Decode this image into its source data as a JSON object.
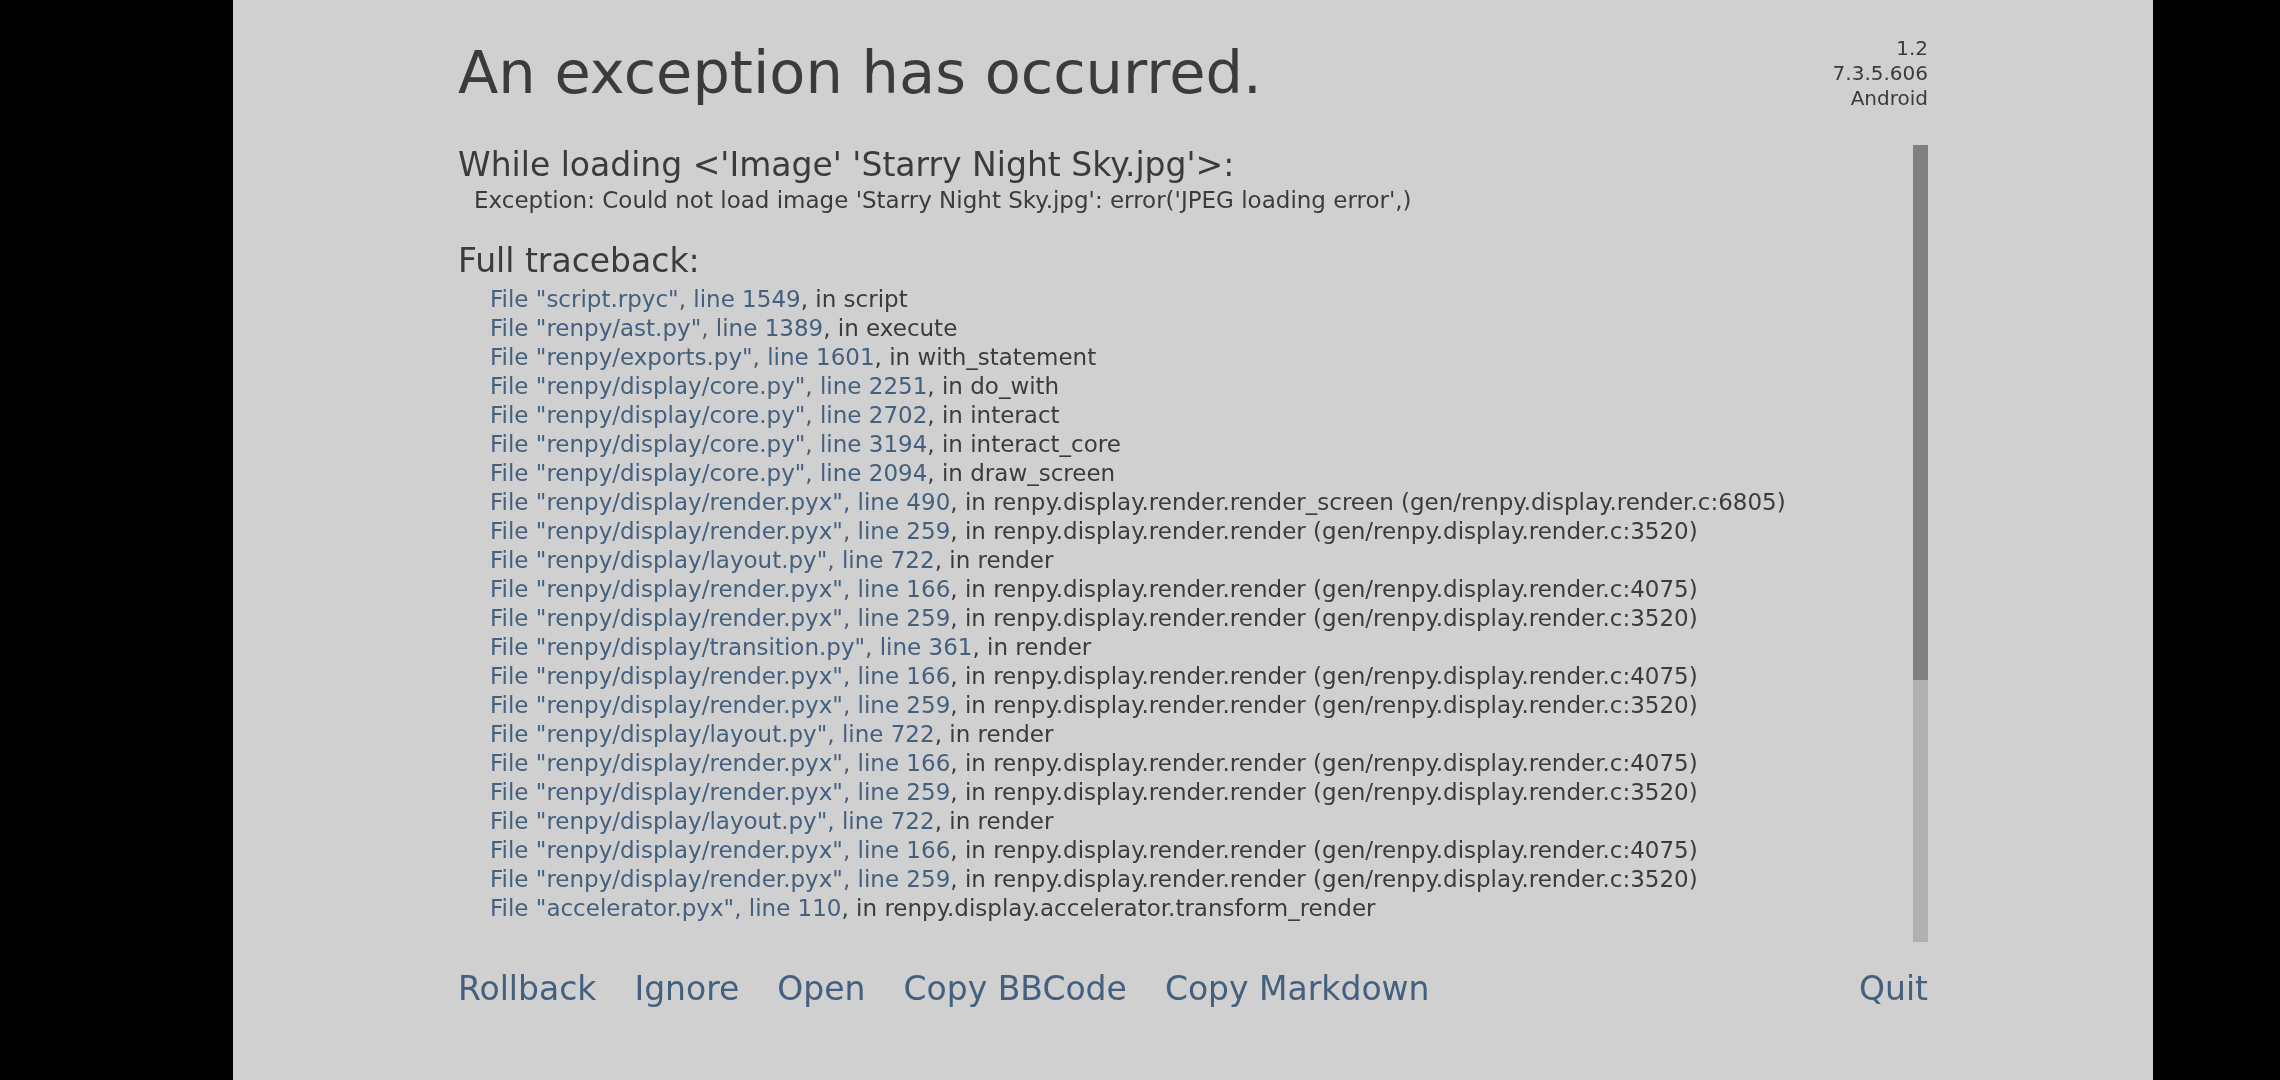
{
  "title": "An exception has occurred.",
  "version_info": [
    "1.2",
    "7.3.5.606",
    "Android"
  ],
  "loading_heading": "While loading <'Image' 'Starry Night Sky.jpg'>:",
  "exception": "Exception: Could not load image 'Starry Night Sky.jpg': error('JPEG loading error',)",
  "traceback_heading": "Full traceback:",
  "traceback": [
    {
      "file": "File \"script.rpyc\", line 1549",
      "rest": ", in script"
    },
    {
      "file": "File \"renpy/ast.py\", line 1389",
      "rest": ", in execute"
    },
    {
      "file": "File \"renpy/exports.py\", line 1601",
      "rest": ", in with_statement"
    },
    {
      "file": "File \"renpy/display/core.py\", line 2251",
      "rest": ", in do_with"
    },
    {
      "file": "File \"renpy/display/core.py\", line 2702",
      "rest": ", in interact"
    },
    {
      "file": "File \"renpy/display/core.py\", line 3194",
      "rest": ", in interact_core"
    },
    {
      "file": "File \"renpy/display/core.py\", line 2094",
      "rest": ", in draw_screen"
    },
    {
      "file": "File \"renpy/display/render.pyx\", line 490",
      "rest": ", in renpy.display.render.render_screen (gen/renpy.display.render.c:6805)"
    },
    {
      "file": "File \"renpy/display/render.pyx\", line 259",
      "rest": ", in renpy.display.render.render (gen/renpy.display.render.c:3520)"
    },
    {
      "file": "File \"renpy/display/layout.py\", line 722",
      "rest": ", in render"
    },
    {
      "file": "File \"renpy/display/render.pyx\", line 166",
      "rest": ", in renpy.display.render.render (gen/renpy.display.render.c:4075)"
    },
    {
      "file": "File \"renpy/display/render.pyx\", line 259",
      "rest": ", in renpy.display.render.render (gen/renpy.display.render.c:3520)"
    },
    {
      "file": "File \"renpy/display/transition.py\", line 361",
      "rest": ", in render"
    },
    {
      "file": "File \"renpy/display/render.pyx\", line 166",
      "rest": ", in renpy.display.render.render (gen/renpy.display.render.c:4075)"
    },
    {
      "file": "File \"renpy/display/render.pyx\", line 259",
      "rest": ", in renpy.display.render.render (gen/renpy.display.render.c:3520)"
    },
    {
      "file": "File \"renpy/display/layout.py\", line 722",
      "rest": ", in render"
    },
    {
      "file": "File \"renpy/display/render.pyx\", line 166",
      "rest": ", in renpy.display.render.render (gen/renpy.display.render.c:4075)"
    },
    {
      "file": "File \"renpy/display/render.pyx\", line 259",
      "rest": ", in renpy.display.render.render (gen/renpy.display.render.c:3520)"
    },
    {
      "file": "File \"renpy/display/layout.py\", line 722",
      "rest": ", in render"
    },
    {
      "file": "File \"renpy/display/render.pyx\", line 166",
      "rest": ", in renpy.display.render.render (gen/renpy.display.render.c:4075)"
    },
    {
      "file": "File \"renpy/display/render.pyx\", line 259",
      "rest": ", in renpy.display.render.render (gen/renpy.display.render.c:3520)"
    },
    {
      "file": "File \"accelerator.pyx\", line 110",
      "rest": ", in renpy.display.accelerator.transform_render"
    }
  ],
  "actions": [
    "Rollback",
    "Ignore",
    "Open",
    "Copy BBCode",
    "Copy Markdown"
  ],
  "quit": "Quit"
}
